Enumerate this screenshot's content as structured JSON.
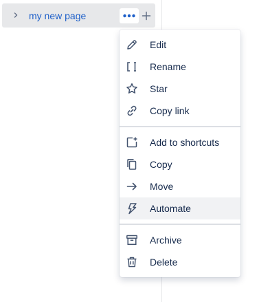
{
  "sidebar": {
    "page": {
      "title": "my new page",
      "expand_icon": "chevron-right-icon",
      "more_icon": "more-horizontal-icon",
      "add_icon": "plus-icon"
    }
  },
  "menu": {
    "groups": [
      [
        {
          "label": "Edit",
          "icon": "pencil-icon"
        },
        {
          "label": "Rename",
          "icon": "rename-cursor-icon"
        },
        {
          "label": "Star",
          "icon": "star-icon"
        },
        {
          "label": "Copy link",
          "icon": "link-icon"
        }
      ],
      [
        {
          "label": "Add to shortcuts",
          "icon": "add-shortcut-icon"
        },
        {
          "label": "Copy",
          "icon": "copy-icon"
        },
        {
          "label": "Move",
          "icon": "arrow-right-icon"
        },
        {
          "label": "Automate",
          "icon": "lightning-icon",
          "hovered": true
        }
      ],
      [
        {
          "label": "Archive",
          "icon": "archive-icon"
        },
        {
          "label": "Delete",
          "icon": "trash-icon"
        }
      ]
    ]
  },
  "colors": {
    "link_blue": "#1d5fc9",
    "text": "#172b4d",
    "icon": "#44546f",
    "hover_bg": "#f1f2f4",
    "row_bg": "#e7e8ea"
  }
}
